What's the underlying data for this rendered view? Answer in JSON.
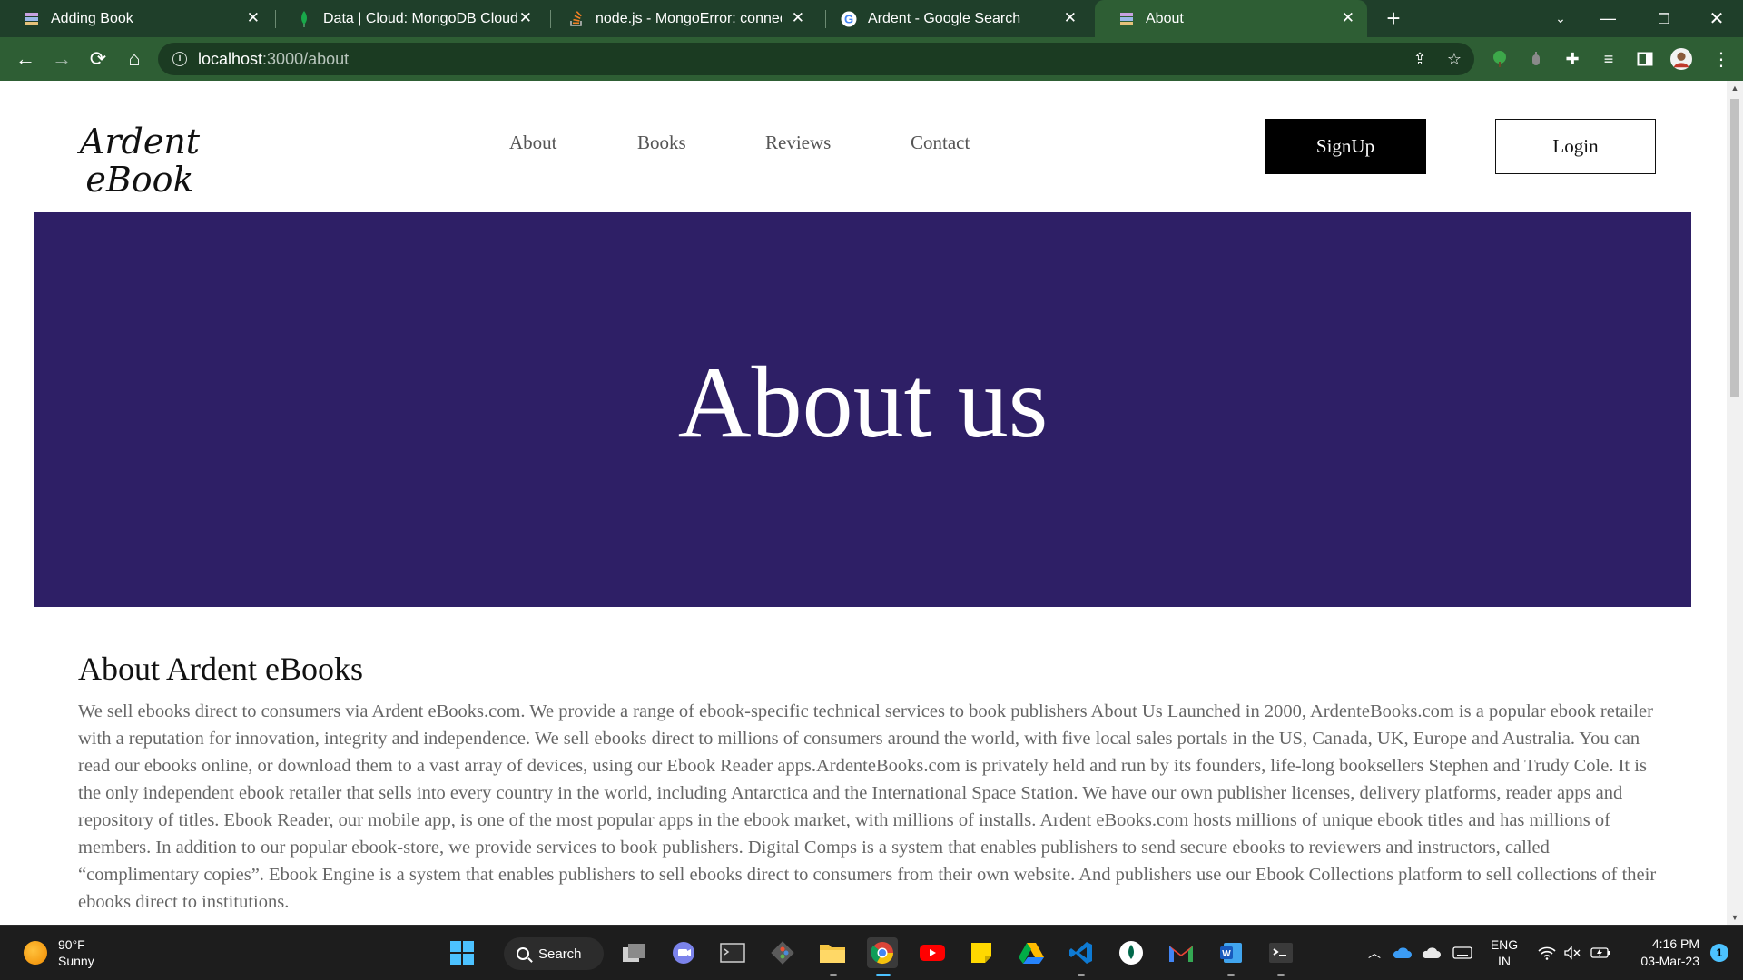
{
  "browser": {
    "tabs": [
      {
        "title": "Adding Book",
        "icon": "books-favicon",
        "active": false
      },
      {
        "title": "Data | Cloud: MongoDB Cloud",
        "icon": "mongodb-leaf-favicon",
        "active": false
      },
      {
        "title": "node.js - MongoError: connect EC",
        "icon": "stackoverflow-favicon",
        "active": false
      },
      {
        "title": "Ardent - Google Search",
        "icon": "google-favicon",
        "active": false
      },
      {
        "title": "About",
        "icon": "books-favicon",
        "active": true
      }
    ],
    "url_host": "localhost",
    "url_path": ":3000/about"
  },
  "site": {
    "logo_line1": "Ardent",
    "logo_line2": "eBook",
    "nav": [
      "About",
      "Books",
      "Reviews",
      "Contact"
    ],
    "signup_label": "SignUp",
    "login_label": "Login"
  },
  "hero": {
    "title": "About us",
    "bg_color": "#2e1f66"
  },
  "about": {
    "heading": "About Ardent eBooks",
    "body": "We sell ebooks direct to consumers via Ardent eBooks.com. We provide a range of ebook-specific technical services to book publishers About Us Launched in 2000, ArdenteBooks.com is a popular ebook retailer with a reputation for innovation, integrity and independence. We sell ebooks direct to millions of consumers around the world, with five local sales portals in the US, Canada, UK, Europe and Australia. You can read our ebooks online, or download them to a vast array of devices, using our Ebook Reader apps.ArdenteBooks.com is privately held and run by its founders, life-long booksellers Stephen and Trudy Cole. It is the only independent ebook retailer that sells into every country in the world, including Antarctica and the International Space Station. We have our own publisher licenses, delivery platforms, reader apps and repository of titles. Ebook Reader, our mobile app, is one of the most popular apps in the ebook market, with millions of installs. Ardent eBooks.com hosts millions of unique ebook titles and has millions of members. In addition to our popular ebook-store, we provide services to book publishers. Digital Comps is a system that enables publishers to send secure ebooks to reviewers and instructors, called “complimentary copies”. Ebook Engine is a system that enables publishers to sell ebooks direct to consumers from their own website. And publishers use our Ebook Collections platform to sell collections of their ebooks direct to institutions."
  },
  "taskbar": {
    "weather_temp": "90°F",
    "weather_desc": "Sunny",
    "search_label": "Search",
    "lang_line1": "ENG",
    "lang_line2": "IN",
    "time": "4:16 PM",
    "date": "03-Mar-23",
    "notification_count": "1"
  }
}
